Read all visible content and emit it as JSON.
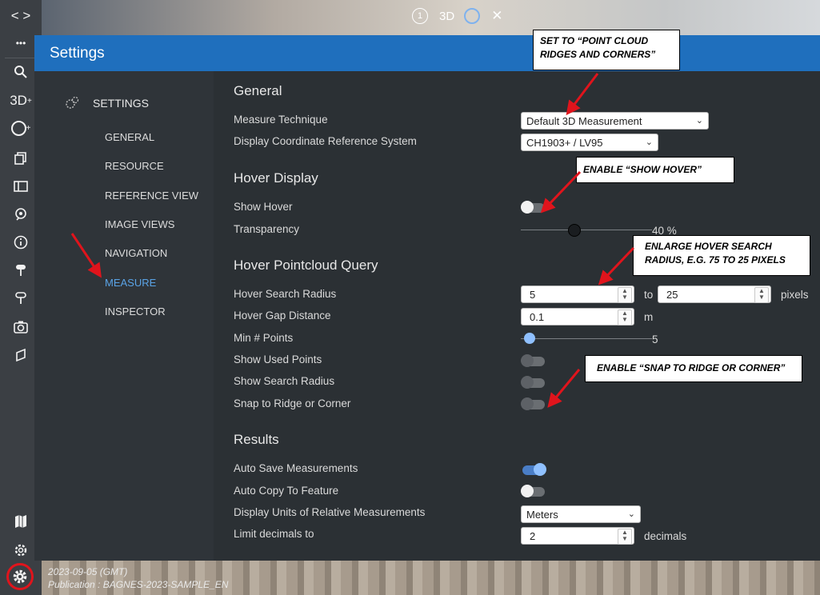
{
  "toolbar": {
    "nav_arrows": "< >",
    "more": "•••",
    "btn_3d": "3D",
    "btn_3d_plus": "+",
    "btn_circle_plus": "+"
  },
  "top_controls": {
    "step_number": "1",
    "label_3d": "3D",
    "close": "✕"
  },
  "panel": {
    "title": "Settings"
  },
  "nav": {
    "heading": "SETTINGS",
    "items": [
      {
        "label": "GENERAL",
        "active": false
      },
      {
        "label": "RESOURCE",
        "active": false
      },
      {
        "label": "REFERENCE VIEW",
        "active": false
      },
      {
        "label": "IMAGE VIEWS",
        "active": false
      },
      {
        "label": "NAVIGATION",
        "active": false
      },
      {
        "label": "MEASURE",
        "active": true
      },
      {
        "label": "INSPECTOR",
        "active": false
      }
    ]
  },
  "general": {
    "title": "General",
    "measure_technique_label": "Measure Technique",
    "measure_technique_value": "Default 3D Measurement",
    "crs_label": "Display Coordinate Reference System",
    "crs_value": "CH1903+ / LV95"
  },
  "hover_display": {
    "title": "Hover Display",
    "show_hover_label": "Show Hover",
    "show_hover": false,
    "transparency_label": "Transparency",
    "transparency_value": 40,
    "transparency_text": "40 %"
  },
  "hover_query": {
    "title": "Hover Pointcloud Query",
    "search_radius_label": "Hover Search Radius",
    "search_radius_min": "5",
    "search_radius_to": "to",
    "search_radius_max": "25",
    "search_radius_unit": "pixels",
    "gap_distance_label": "Hover Gap Distance",
    "gap_distance_value": "0.1",
    "gap_distance_unit": "m",
    "min_points_label": "Min # Points",
    "min_points_value": "5",
    "show_used_points_label": "Show Used Points",
    "show_search_radius_label": "Show Search Radius",
    "snap_label": "Snap to Ridge or Corner"
  },
  "results": {
    "title": "Results",
    "auto_save_label": "Auto Save Measurements",
    "auto_save": true,
    "auto_copy_label": "Auto Copy To Feature",
    "auto_copy": false,
    "units_label": "Display Units of Relative Measurements",
    "units_value": "Meters",
    "decimals_label": "Limit decimals to",
    "decimals_value": "2",
    "decimals_unit": "decimals"
  },
  "callouts": {
    "point_cloud": "SET TO “POINT CLOUD RIDGES AND CORNERS”",
    "show_hover": "ENABLE “SHOW HOVER”",
    "radius": "ENLARGE HOVER SEARCH RADIUS, E.G. 75 TO 25 PIXELS",
    "snap": "ENABLE “SNAP TO RIDGE OR CORNER”"
  },
  "footer": {
    "date": "2023-09-05 (GMT)",
    "publication": "Publication : BAGNES-2023-SAMPLE_EN"
  },
  "colors": {
    "header_blue": "#1f6fbd",
    "active_nav": "#5aa3e6",
    "arrow_red": "#e0141c",
    "toggle_on": "#4a7ec7"
  }
}
